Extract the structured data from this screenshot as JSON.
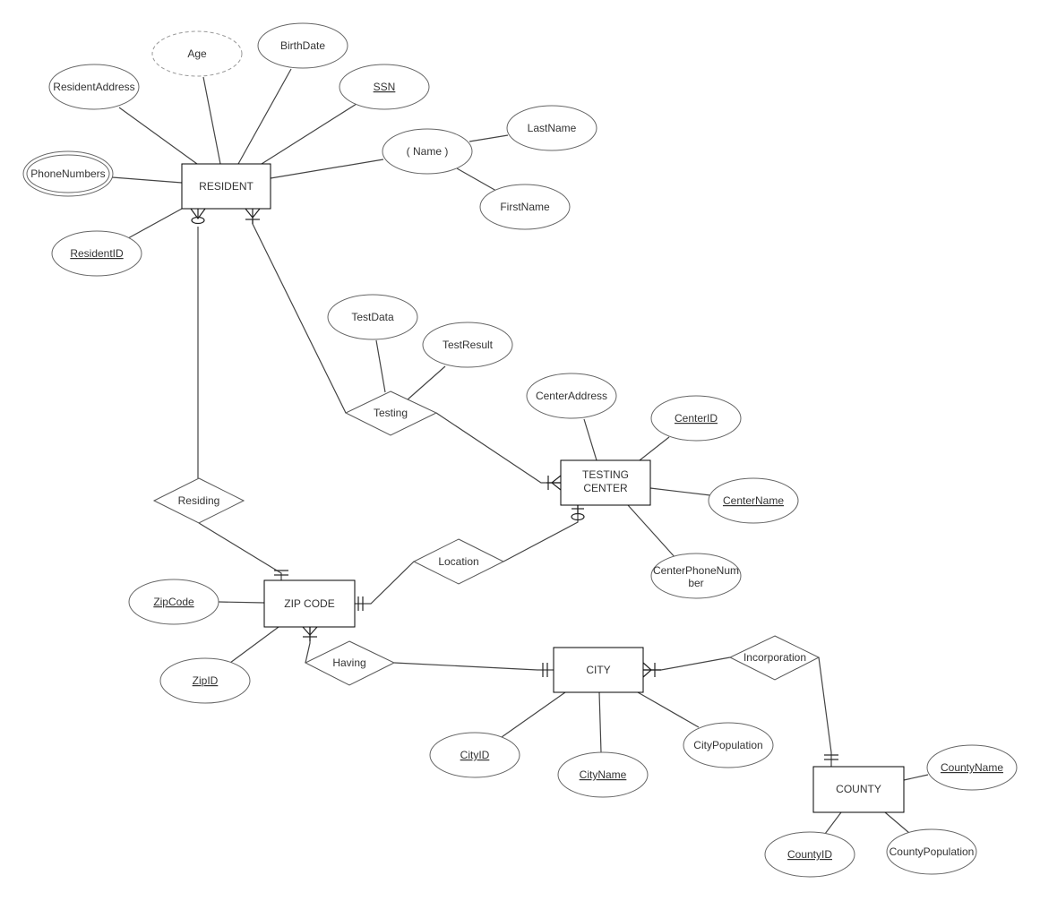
{
  "diagram": {
    "type": "ER diagram",
    "entities": {
      "resident": "RESIDENT",
      "testing_center_1": "TESTING",
      "testing_center_2": "CENTER",
      "zip_code": "ZIP CODE",
      "city": "CITY",
      "county": "COUNTY"
    },
    "relationships": {
      "testing": "Testing",
      "residing": "Residing",
      "location": "Location",
      "having": "Having",
      "incorporation": "Incorporation"
    },
    "attributes": {
      "age": "Age",
      "birth_date": "BirthDate",
      "resident_address": "ResidentAddress",
      "ssn": "SSN",
      "name": "( Name )",
      "last_name": "LastName",
      "first_name": "FirstName",
      "phone_numbers": "PhoneNumbers",
      "resident_id": "ResidentID",
      "test_data": "TestData",
      "test_result": "TestResult",
      "center_address": "CenterAddress",
      "center_id": "CenterID",
      "center_name": "CenterName",
      "center_phone_1": "CenterPhoneNum",
      "center_phone_2": "ber",
      "zip_code": "ZipCode",
      "zip_id": "ZipID",
      "city_id": "CityID",
      "city_name": "CityName",
      "city_population": "CityPopulation",
      "county_name": "CountyName",
      "county_id": "CountyID",
      "county_population": "CountyPopulation"
    }
  }
}
